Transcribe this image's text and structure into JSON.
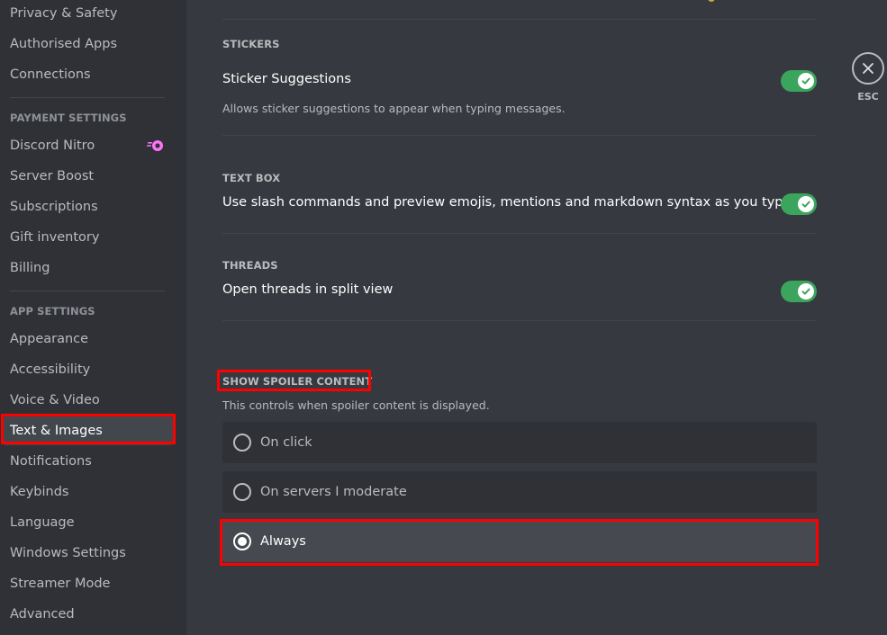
{
  "sidebar": {
    "user_items": [
      {
        "label": "Privacy & Safety"
      },
      {
        "label": "Authorised Apps"
      },
      {
        "label": "Connections"
      }
    ],
    "payment_header": "PAYMENT SETTINGS",
    "payment_items": [
      {
        "label": "Discord Nitro",
        "icon": "nitro-icon"
      },
      {
        "label": "Server Boost"
      },
      {
        "label": "Subscriptions"
      },
      {
        "label": "Gift inventory"
      },
      {
        "label": "Billing"
      }
    ],
    "app_header": "APP SETTINGS",
    "app_items": [
      {
        "label": "Appearance"
      },
      {
        "label": "Accessibility"
      },
      {
        "label": "Voice & Video"
      },
      {
        "label": "Text & Images",
        "selected": true
      },
      {
        "label": "Notifications"
      },
      {
        "label": "Keybinds"
      },
      {
        "label": "Language"
      },
      {
        "label": "Windows Settings"
      },
      {
        "label": "Streamer Mode"
      },
      {
        "label": "Advanced"
      }
    ]
  },
  "content": {
    "stickers": {
      "section_title": "STICKERS",
      "setting_title": "Sticker Suggestions",
      "setting_desc": "Allows sticker suggestions to appear when typing messages.",
      "enabled": true
    },
    "text_box": {
      "section_title": "TEXT BOX",
      "setting_title": "Use slash commands and preview emojis, mentions and markdown syntax as you type",
      "enabled": true
    },
    "threads": {
      "section_title": "THREADS",
      "setting_title": "Open threads in split view",
      "enabled": true
    },
    "spoiler": {
      "section_title": "SHOW SPOILER CONTENT",
      "description": "This controls when spoiler content is displayed.",
      "options": [
        {
          "label": "On click",
          "selected": false
        },
        {
          "label": "On servers I moderate",
          "selected": false
        },
        {
          "label": "Always",
          "selected": true
        }
      ]
    }
  },
  "close": {
    "icon": "close-icon",
    "label": "ESC"
  },
  "colors": {
    "toggle_on": "#3ba55d",
    "highlight": "#ff0000",
    "nitro": "#ff73fa"
  }
}
